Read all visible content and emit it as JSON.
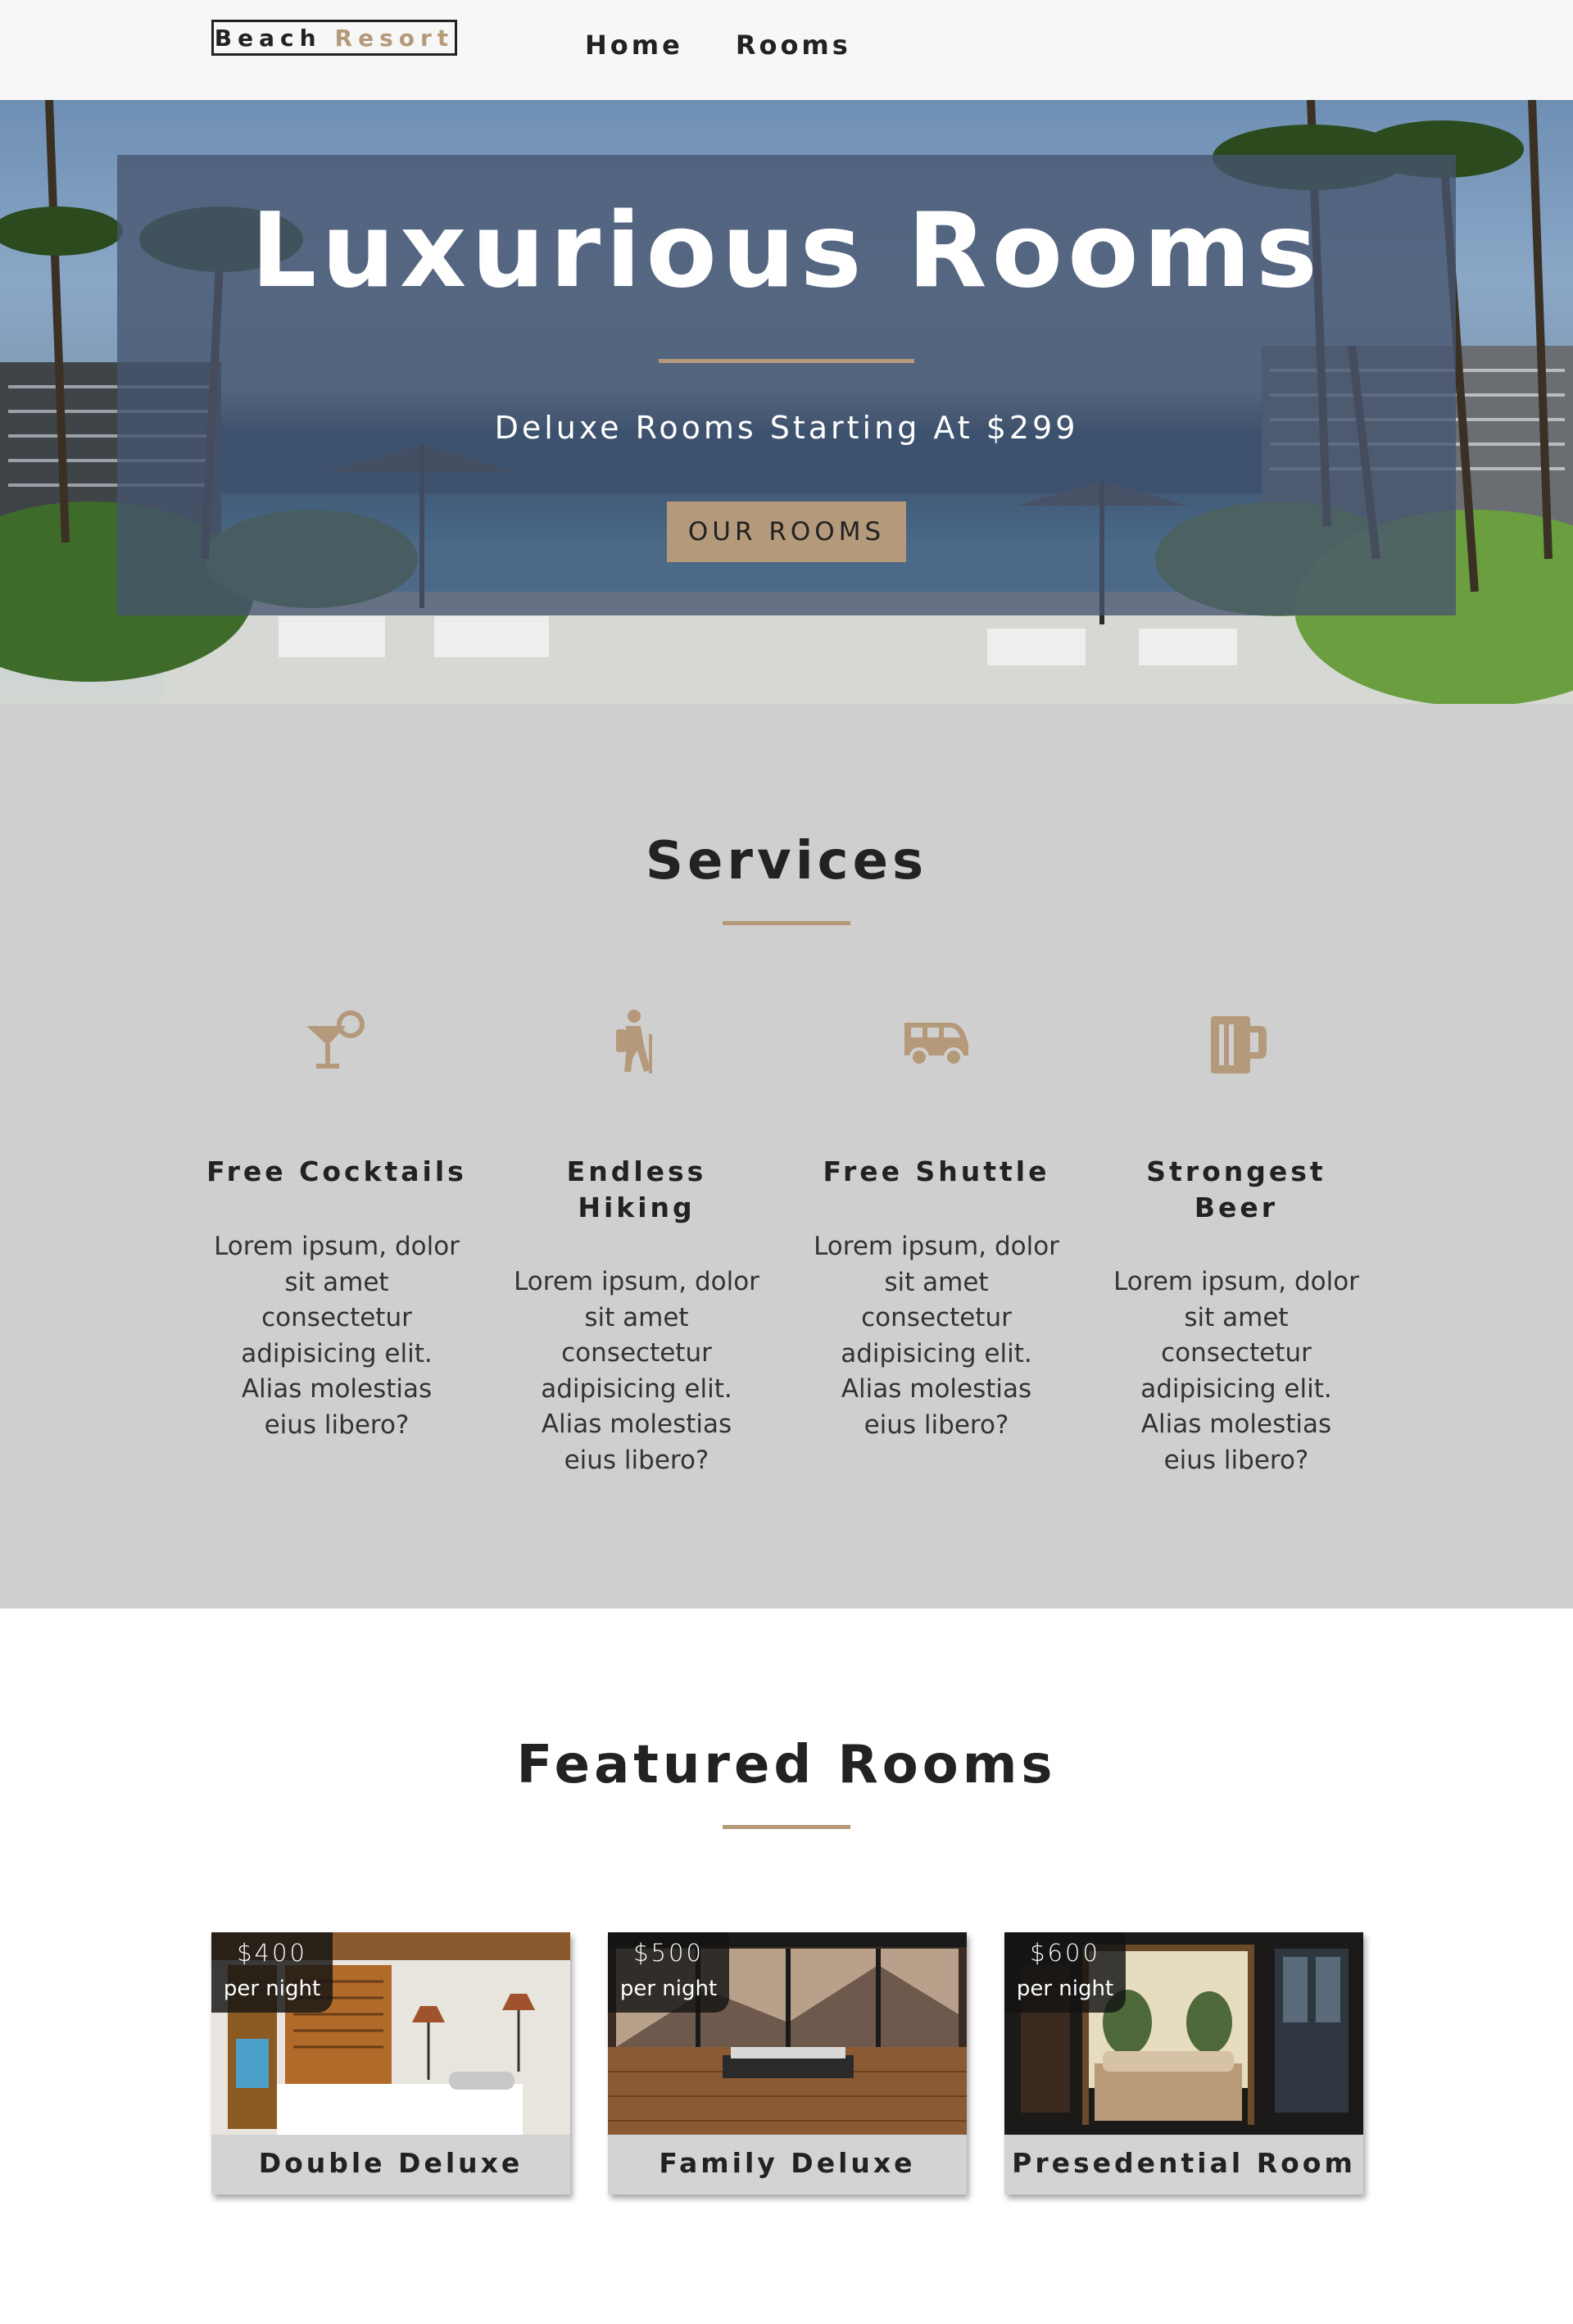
{
  "nav": {
    "logo_part1": "Beach",
    "logo_part2": "Resort",
    "links": [
      {
        "label": "Home"
      },
      {
        "label": "Rooms"
      }
    ]
  },
  "hero": {
    "title": "Luxurious Rooms",
    "subtitle": "Deluxe Rooms Starting At $299",
    "button_label": "OUR ROOMS"
  },
  "services": {
    "title": "Services",
    "items": [
      {
        "icon": "cocktail-icon",
        "title_lines": [
          "Free Cocktails"
        ],
        "text_lines": [
          "Lorem ipsum, dolor",
          "sit amet",
          "consectetur",
          "adipisicing elit.",
          "Alias molestias",
          "eius libero?"
        ]
      },
      {
        "icon": "hiking-icon",
        "title_lines": [
          "Endless",
          "Hiking"
        ],
        "text_lines": [
          "Lorem ipsum, dolor",
          "sit amet",
          "consectetur",
          "adipisicing elit.",
          "Alias molestias",
          "eius libero?"
        ]
      },
      {
        "icon": "shuttle-icon",
        "title_lines": [
          "Free Shuttle"
        ],
        "text_lines": [
          "Lorem ipsum, dolor",
          "sit amet",
          "consectetur",
          "adipisicing elit.",
          "Alias molestias",
          "eius libero?"
        ]
      },
      {
        "icon": "beer-icon",
        "title_lines": [
          "Strongest",
          "Beer"
        ],
        "text_lines": [
          "Lorem ipsum, dolor",
          "sit amet",
          "consectetur",
          "adipisicing elit.",
          "Alias molestias",
          "eius libero?"
        ]
      }
    ]
  },
  "featured": {
    "title": "Featured Rooms",
    "rooms": [
      {
        "price": "$400",
        "per": "per night",
        "name": "Double Deluxe"
      },
      {
        "price": "$500",
        "per": "per night",
        "name": "Family Deluxe"
      },
      {
        "price": "$600",
        "per": "per night",
        "name": "Presedential Room"
      }
    ]
  },
  "colors": {
    "accent": "#b49a7a",
    "nav_bg": "#f7f7f7",
    "services_bg": "#cfcfcf",
    "text": "#222222"
  }
}
